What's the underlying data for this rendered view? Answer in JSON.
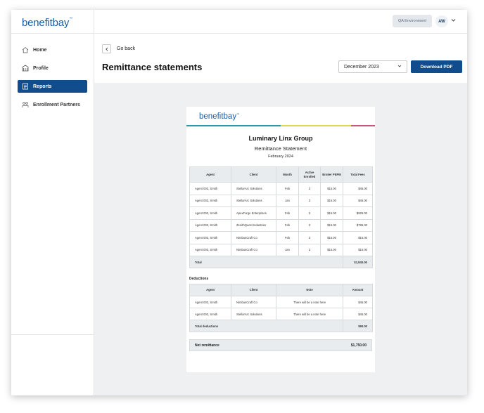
{
  "app": {
    "logo": "benefitbay",
    "environment_badge": "QA Environment",
    "user_initials": "AW"
  },
  "sidebar": {
    "items": [
      {
        "label": "Home",
        "icon": "home-icon",
        "active": false
      },
      {
        "label": "Profile",
        "icon": "profile-icon",
        "active": false
      },
      {
        "label": "Reports",
        "icon": "reports-icon",
        "active": true
      },
      {
        "label": "Enrollment Partners",
        "icon": "partners-icon",
        "active": false
      }
    ]
  },
  "header": {
    "back_label": "Go back",
    "title": "Remittance statements",
    "month_select": "December 2023",
    "download_label": "Download PDF"
  },
  "document": {
    "logo": "benefitbay",
    "company": "Luminary Linx Group",
    "statement_title": "Remittance Statement",
    "period": "February 2024",
    "rainbow_colors": [
      "#2a9aa3",
      "#d9d94a",
      "#c6587a"
    ],
    "main_table": {
      "headers": [
        "Agent",
        "Client",
        "Month",
        "Active Enrolled",
        "Broker PEPM",
        "Total Fees"
      ],
      "rows": [
        [
          "Agent 003, Smith",
          "StellarArc Solutions",
          "Feb",
          "3",
          "$15.00",
          "$45.00"
        ],
        [
          "Agent 003, Smith",
          "StellarArc Solutions",
          "Jan",
          "3",
          "$15.00",
          "$45.00"
        ],
        [
          "Agent 003, Smith",
          "ApexForge Enterprises",
          "Feb",
          "3",
          "$15.00",
          "$925.00"
        ],
        [
          "Agent 003, Smith",
          "ZenithQuest Industries",
          "Feb",
          "3",
          "$15.00",
          "$795.00"
        ],
        [
          "Agent 003, Smith",
          "NimbusCraft Co",
          "Feb",
          "3",
          "$15.00",
          "$15.00"
        ],
        [
          "Agent 003, Smith",
          "NimbusCraft Co",
          "Jan",
          "3",
          "$15.00",
          "$15.00"
        ]
      ],
      "total_label": "Total",
      "total_value": "$1,840.00"
    },
    "deductions": {
      "label": "Deductions",
      "headers": [
        "Agent",
        "Client",
        "Note",
        "Amount"
      ],
      "rows": [
        [
          "Agent 003, Smith",
          "NimbusCraft Co",
          "There will be a note here",
          "$45.00"
        ],
        [
          "Agent 003, Smith",
          "StellarArc Solutions",
          "There will be a note here",
          "$45.00"
        ]
      ],
      "total_label": "Total deductions",
      "total_value": "$90.00"
    },
    "net_label": "Net remittance",
    "net_value": "$1,750.00"
  }
}
